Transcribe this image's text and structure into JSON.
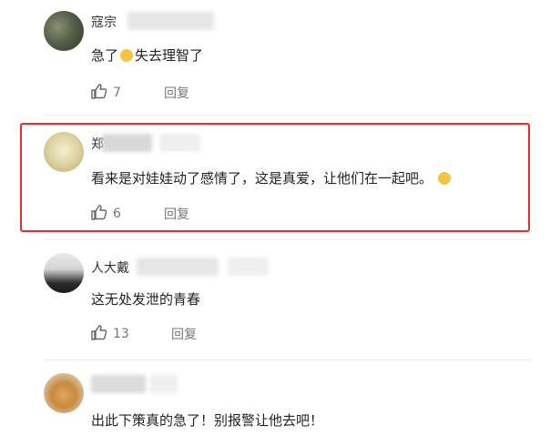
{
  "comments": [
    {
      "username": "寇宗",
      "text": "急了",
      "text_after_emoji": "失去理智了",
      "emoji": "emoji-sweat",
      "likes": "7",
      "reply_label": "回复"
    },
    {
      "username": "郑",
      "text": "看来是对娃娃动了感情了，这是真爱，让他们在一起吧。",
      "emoji": "emoji-laugh-cry",
      "likes": "6",
      "reply_label": "回复"
    },
    {
      "username": "人大戴",
      "text": "这无处发泄的青春",
      "likes": "13",
      "reply_label": "回复"
    },
    {
      "username": "",
      "text": "出此下策真的急了！别报警让他去吧！"
    }
  ],
  "colors": {
    "highlight": "#e53030",
    "emoji": "#f5c542"
  }
}
